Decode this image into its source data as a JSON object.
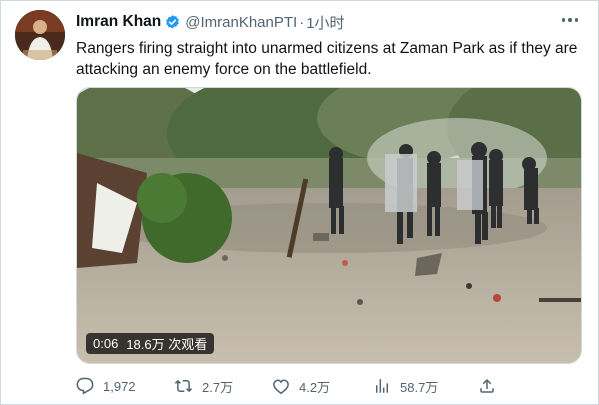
{
  "tweet": {
    "author_name": "Imran Khan",
    "handle": "@ImranKhanPTI",
    "separator": "·",
    "time": "1小时",
    "text": "Rangers firing straight into unarmed citizens at Zaman Park as if they are attacking an enemy force on the battlefield.",
    "verified_color": "#1d9bf0",
    "avatar_icon": "avatar-portrait"
  },
  "video": {
    "duration": "0:06",
    "views": "18.6万 次观看"
  },
  "actions": {
    "replies": "1,972",
    "retweets": "2.7万",
    "likes": "4.2万",
    "views": "58.7万"
  },
  "icons": {
    "more": "more-icon",
    "reply": "reply-icon",
    "retweet": "retweet-icon",
    "like": "heart-icon",
    "views": "views-chart-icon",
    "share": "share-icon"
  }
}
